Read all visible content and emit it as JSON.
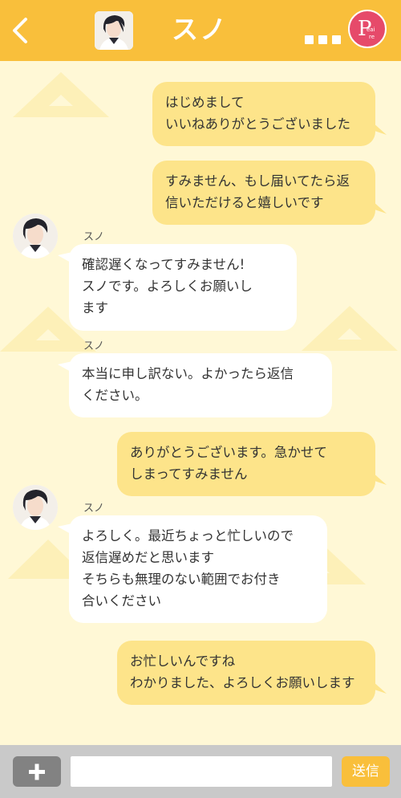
{
  "header": {
    "title": "スノ",
    "brand_logo_text": "Pearre"
  },
  "messages": [
    {
      "side": "sent",
      "text": "はじめまして\nいいねありがとうございました"
    },
    {
      "side": "sent",
      "text": "すみません、もし届いてたら返\n信いただけると嬉しいです"
    },
    {
      "side": "recv",
      "sender": "スノ",
      "text": "確認遅くなってすみません!\nスノです。よろしくお願いし\nます"
    },
    {
      "side": "recv",
      "sender": "スノ",
      "text": "本当に申し訳ない。よかったら返信\nください。"
    },
    {
      "side": "sent",
      "text": "ありがとうございます。急かせて\nしまってすみません"
    },
    {
      "side": "recv",
      "sender": "スノ",
      "text": "よろしく。最近ちょっと忙しいので\n返信遅めだと思います\nそちらも無理のない範囲でお付き\n合いください"
    },
    {
      "side": "sent",
      "text": "お忙しいんですね\nわかりました、よろしくお願いします"
    }
  ],
  "input": {
    "value": "",
    "placeholder": "",
    "send_label": "送信"
  },
  "colors": {
    "header": "#f9bf3b",
    "background": "#fff8d6",
    "sent_bubble": "#fde48a",
    "recv_bubble": "#ffffff"
  }
}
